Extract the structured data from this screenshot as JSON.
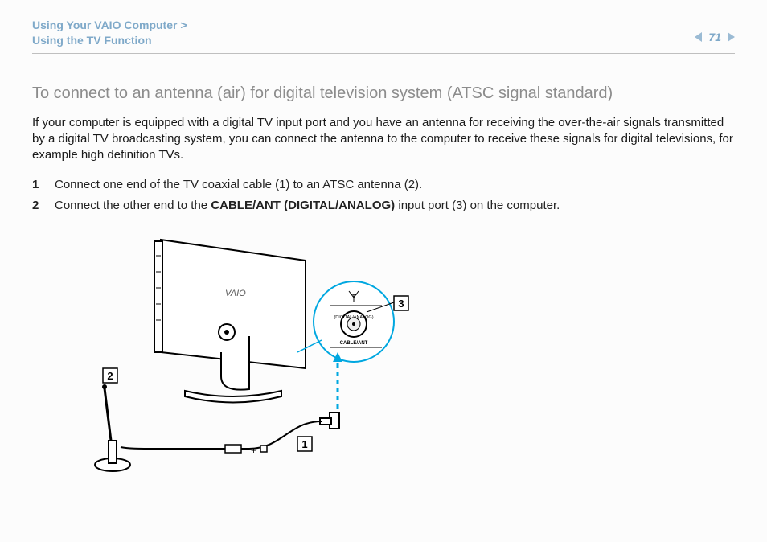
{
  "header": {
    "breadcrumb_line1": "Using Your VAIO Computer >",
    "breadcrumb_line2": "Using the TV Function",
    "page_number": "71"
  },
  "section": {
    "title": "To connect to an antenna (air) for digital television system (ATSC signal standard)",
    "intro": "If your computer is equipped with a digital TV input port and you have an antenna for receiving the over-the-air signals transmitted by a digital TV broadcasting system, you can connect the antenna to the computer to receive these signals for digital televisions, for example high definition TVs."
  },
  "steps": [
    {
      "num": "1",
      "text": "Connect one end of the TV coaxial cable (1) to an ATSC antenna (2)."
    },
    {
      "num": "2",
      "prefix": "Connect the other end to the ",
      "bold": "CABLE/ANT (DIGITAL/ANALOG)",
      "suffix": " input port (3) on the computer."
    }
  ],
  "diagram": {
    "callout_1": "1",
    "callout_2": "2",
    "callout_3": "3",
    "port_label_top": "(DIGITAL/ANALOG)",
    "port_label_bottom": "CABLE/ANT",
    "brand": "VAIO"
  }
}
